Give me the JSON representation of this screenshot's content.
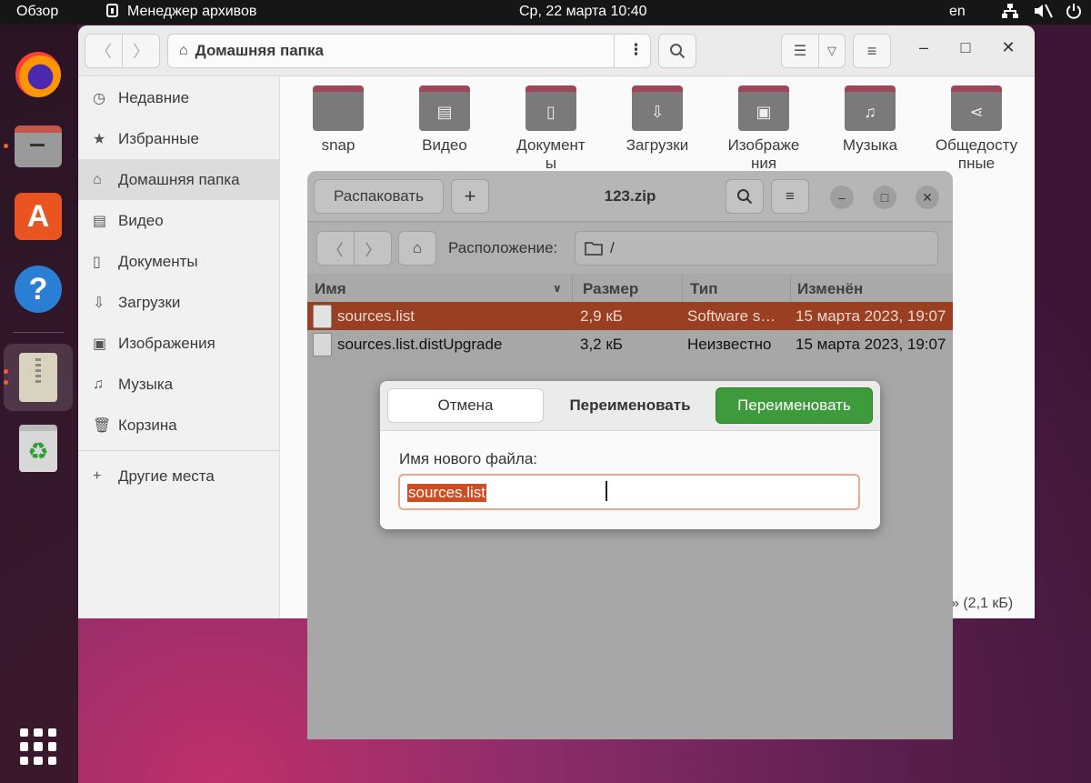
{
  "topbar": {
    "activities": "Обзор",
    "app_name": "Менеджер архивов",
    "clock": "Ср, 22 марта  10:40",
    "lang": "en"
  },
  "dock": {
    "items": [
      "firefox",
      "files",
      "app-center",
      "help",
      "archive-manager",
      "trash",
      "show-apps"
    ]
  },
  "nautilus": {
    "path": "Домашняя папка",
    "sidebar": [
      {
        "icon": "clock-icon",
        "label": "Недавние"
      },
      {
        "icon": "star-icon",
        "label": "Избранные"
      },
      {
        "icon": "home-icon",
        "label": "Домашняя папка",
        "active": true
      },
      {
        "icon": "video-icon",
        "label": "Видео"
      },
      {
        "icon": "document-icon",
        "label": "Документы"
      },
      {
        "icon": "download-icon",
        "label": "Загрузки"
      },
      {
        "icon": "image-icon",
        "label": "Изображения"
      },
      {
        "icon": "music-icon",
        "label": "Музыка"
      },
      {
        "icon": "trash-icon",
        "label": "Корзина"
      },
      {
        "icon": "plus-icon",
        "label": "Другие места"
      }
    ],
    "folders": [
      {
        "line1": "snap",
        "line2": ""
      },
      {
        "line1": "Видео",
        "line2": ""
      },
      {
        "line1": "Документ",
        "line2": "ы"
      },
      {
        "line1": "Загрузки",
        "line2": ""
      },
      {
        "line1": "Изображе",
        "line2": "ния"
      },
      {
        "line1": "Музыка",
        "line2": ""
      },
      {
        "line1": "Общедосту",
        "line2": "пные"
      }
    ],
    "status": "» (2,1 кБ)"
  },
  "archive": {
    "title": "123.zip",
    "extract_label": "Распаковать",
    "location_label": "Расположение:",
    "location_value": "/",
    "columns": {
      "name": "Имя",
      "size": "Размер",
      "type": "Тип",
      "modified": "Изменён"
    },
    "rows": [
      {
        "name": "sources.list",
        "size": "2,9 кБ",
        "type": "Software s…",
        "modified": "15 марта 2023, 19:07",
        "selected": true
      },
      {
        "name": "sources.list.distUpgrade",
        "size": "3,2 кБ",
        "type": "Неизвестно",
        "modified": "15 марта 2023, 19:07",
        "selected": false
      }
    ]
  },
  "dialog": {
    "cancel_label": "Отмена",
    "title": "Переименовать",
    "ok_label": "Переименовать",
    "field_label": "Имя нового файла:",
    "field_value": "sources.list"
  },
  "colors": {
    "accent": "#e95420",
    "selection": "#9a3f22",
    "ok_button": "#3e9b3b"
  }
}
